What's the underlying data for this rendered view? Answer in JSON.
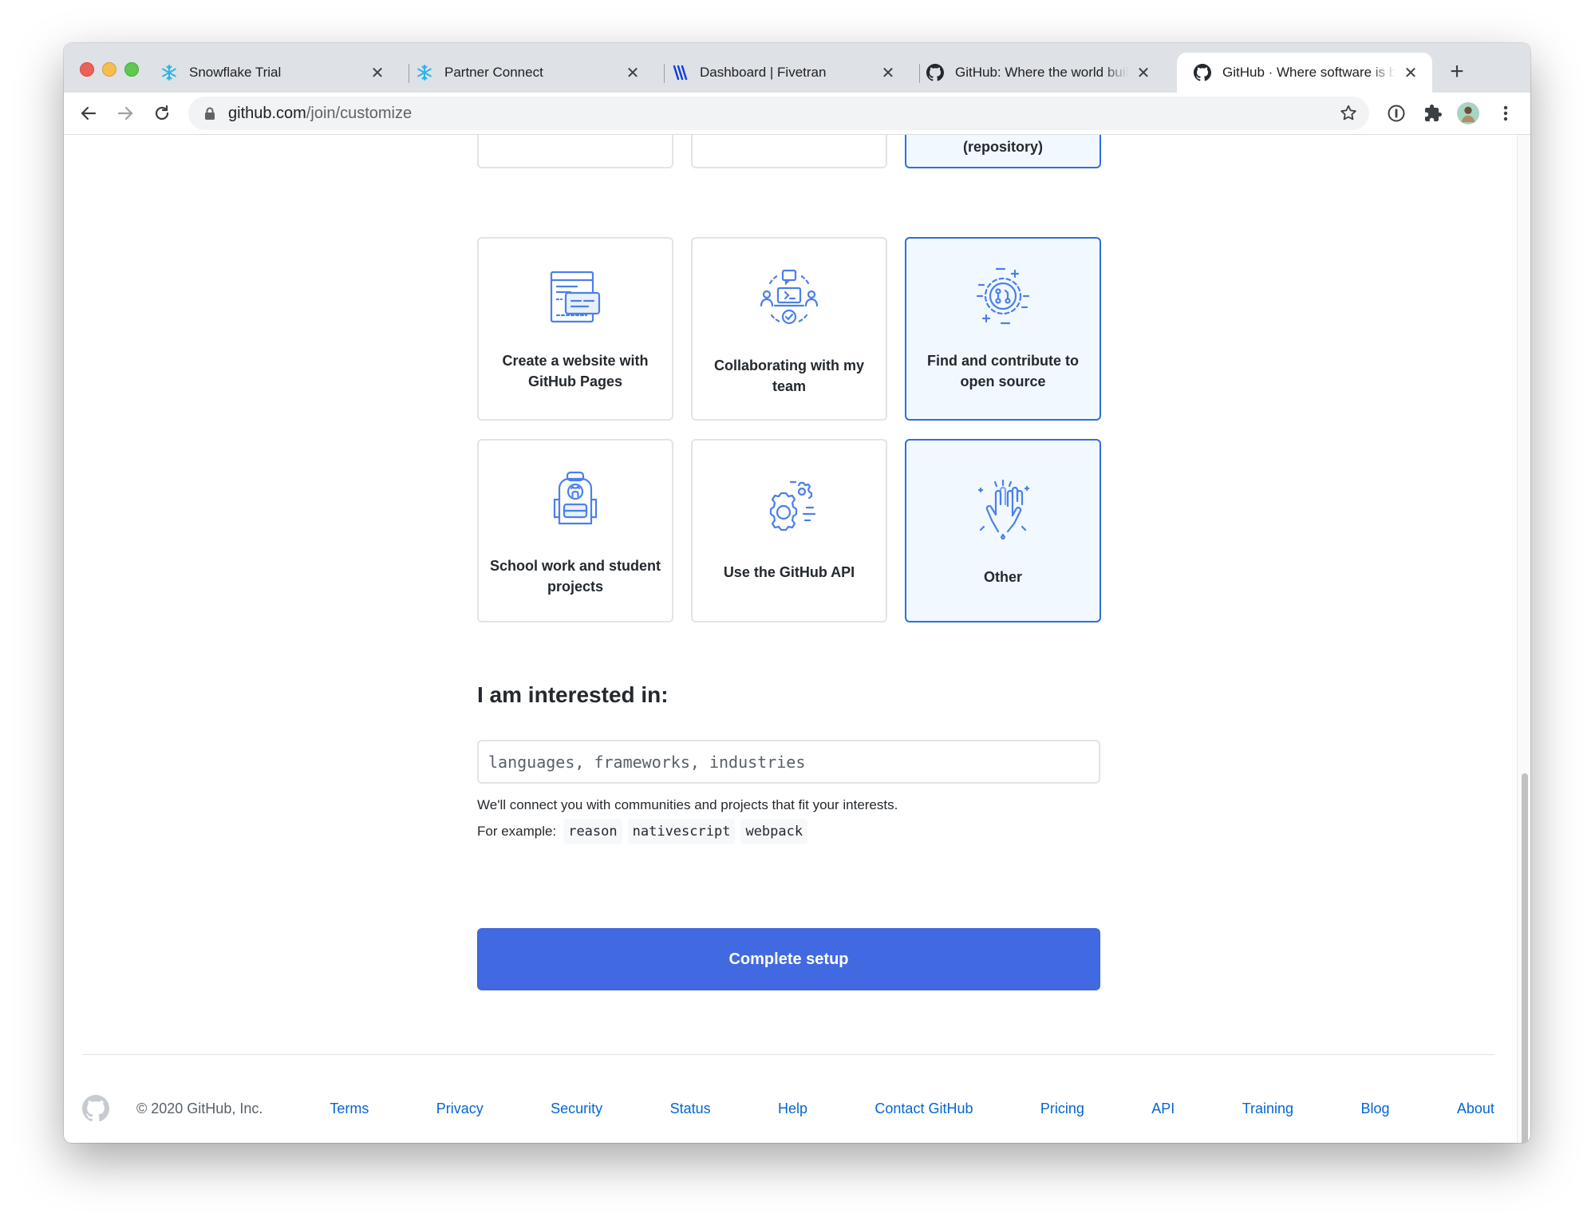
{
  "browser": {
    "tabs": [
      {
        "title": "Snowflake Trial",
        "icon": "snowflake-icon"
      },
      {
        "title": "Partner Connect",
        "icon": "snowflake-icon"
      },
      {
        "title": "Dashboard | Fivetran",
        "icon": "fivetran-icon"
      },
      {
        "title": "GitHub: Where the world builds software",
        "icon": "github-icon"
      },
      {
        "title": "GitHub · Where software is built",
        "icon": "github-icon",
        "active": true
      }
    ],
    "url_host": "github.com",
    "url_path": "/join/customize"
  },
  "options": {
    "top_partial": [
      "",
      "",
      "(repository)"
    ],
    "row1": [
      {
        "label": "Create a website with GitHub Pages",
        "icon": "website-icon",
        "selected": false
      },
      {
        "label": "Collaborating with my team",
        "icon": "team-icon",
        "selected": false
      },
      {
        "label": "Find and contribute to open source",
        "icon": "open-source-icon",
        "selected": true
      }
    ],
    "row2": [
      {
        "label": "School work and student projects",
        "icon": "backpack-icon",
        "selected": false
      },
      {
        "label": "Use the GitHub API",
        "icon": "gear-icon",
        "selected": false
      },
      {
        "label": "Other",
        "icon": "high-five-icon",
        "selected": true
      }
    ]
  },
  "interests": {
    "title": "I am interested in:",
    "placeholder": "languages, frameworks, industries",
    "helper": "We'll connect you with communities and projects that fit your interests.",
    "example_label": "For example:",
    "examples": [
      "reason",
      "nativescript",
      "webpack"
    ]
  },
  "cta": {
    "label": "Complete setup"
  },
  "footer": {
    "copyright": "© 2020 GitHub, Inc.",
    "links": [
      "Terms",
      "Privacy",
      "Security",
      "Status",
      "Help",
      "Contact GitHub",
      "Pricing",
      "API",
      "Training",
      "Blog",
      "About"
    ]
  },
  "colors": {
    "accent": "#4169e1",
    "selected_border": "#2f6fdb",
    "selected_bg": "#f1f8ff",
    "link": "#0366d6"
  }
}
